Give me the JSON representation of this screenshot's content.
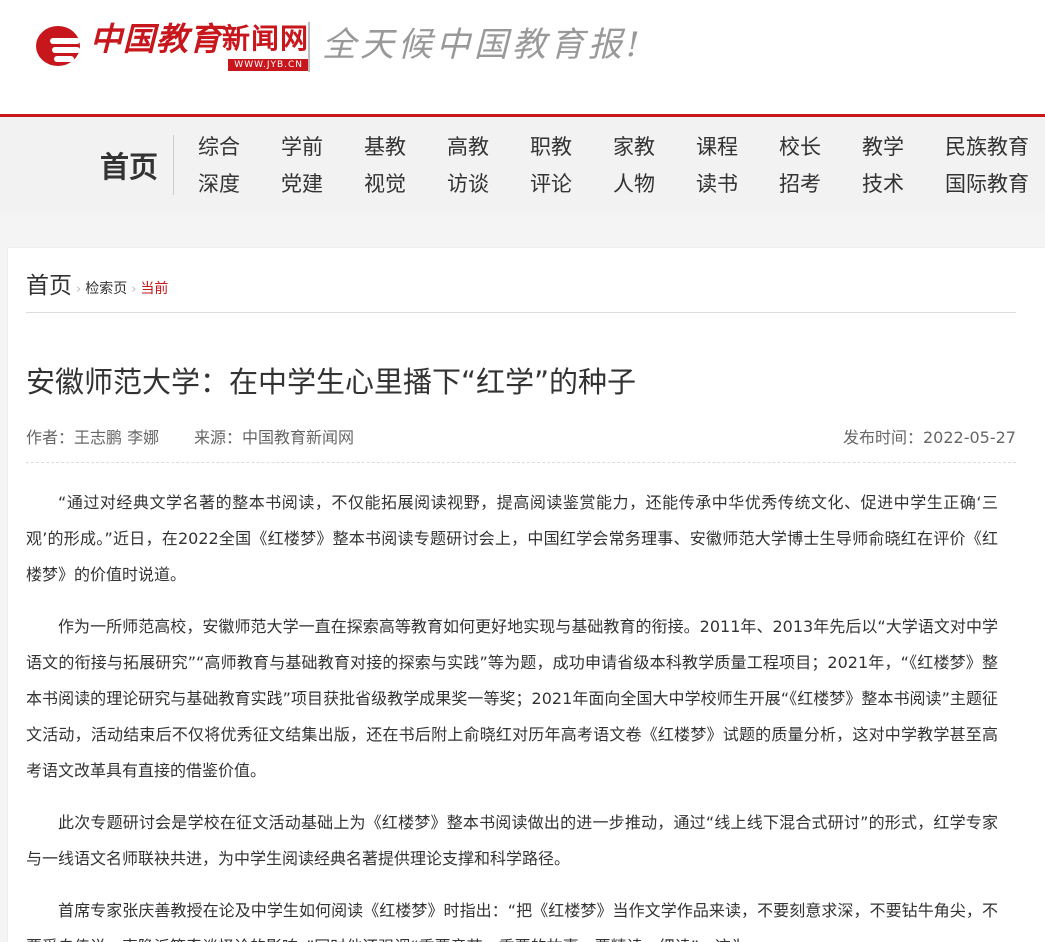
{
  "header": {
    "logo_brand": "中国教育",
    "logo_site": "新闻网",
    "logo_url": "WWW.JYB.CN",
    "slogan": "全天候中国教育报!"
  },
  "nav": {
    "home": "首页",
    "row1": [
      "综合",
      "学前",
      "基教",
      "高教",
      "职教",
      "家教",
      "课程",
      "校长",
      "教学",
      "民族教育"
    ],
    "row2": [
      "深度",
      "党建",
      "视觉",
      "访谈",
      "评论",
      "人物",
      "读书",
      "招考",
      "技术",
      "国际教育"
    ]
  },
  "breadcrumb": {
    "home": "首页",
    "search": "检索页",
    "current": "当前",
    "arrow": "›"
  },
  "article": {
    "title": "安徽师范大学：在中学生心里播下“红学”的种子",
    "author": "作者：王志鹏 李娜",
    "source": "来源：中国教育新闻网",
    "date": "发布时间：2022-05-27",
    "paragraphs": [
      "“通过对经典文学名著的整本书阅读，不仅能拓展阅读视野，提高阅读鉴赏能力，还能传承中华优秀传统文化、促进中学生正确‘三观’的形成。”近日，在2022全国《红楼梦》整本书阅读专题研讨会上，中国红学会常务理事、安徽师范大学博士生导师俞晓红在评价《红楼梦》的价值时说道。",
      "作为一所师范高校，安徽师范大学一直在探索高等教育如何更好地实现与基础教育的衔接。2011年、2013年先后以“大学语文对中学语文的衔接与拓展研究”“高师教育与基础教育对接的探索与实践”等为题，成功申请省级本科教学质量工程项目；2021年，“《红楼梦》整本书阅读的理论研究与基础教育实践”项目获批省级教学成果奖一等奖；2021年面向全国大中学校师生开展“《红楼梦》整本书阅读”主题征文活动，活动结束后不仅将优秀征文结集出版，还在书后附上俞晓红对历年高考语文卷《红楼梦》试题的质量分析，这对中学教学甚至高考语文改革具有直接的借鉴价值。",
      "此次专题研讨会是学校在征文活动基础上为《红楼梦》整本书阅读做出的进一步推动，通过“线上线下混合式研讨”的形式，红学专家与一线语文名师联袂共进，为中学生阅读经典名著提供理论支撑和科学路径。",
      "首席专家张庆善教授在论及中学生如何阅读《红楼梦》时指出：“把《红楼梦》当作文学作品来读，不要刻意求深，不要钻牛角尖，不要受自传说、索隐派等奇谈怪论的影响。”同时他还强调“重要章节，重要的故事，要精读、细读”。这为"
    ]
  },
  "colors": {
    "brand_red": "#c8161d",
    "nav_bg": "#f2f2f2"
  }
}
